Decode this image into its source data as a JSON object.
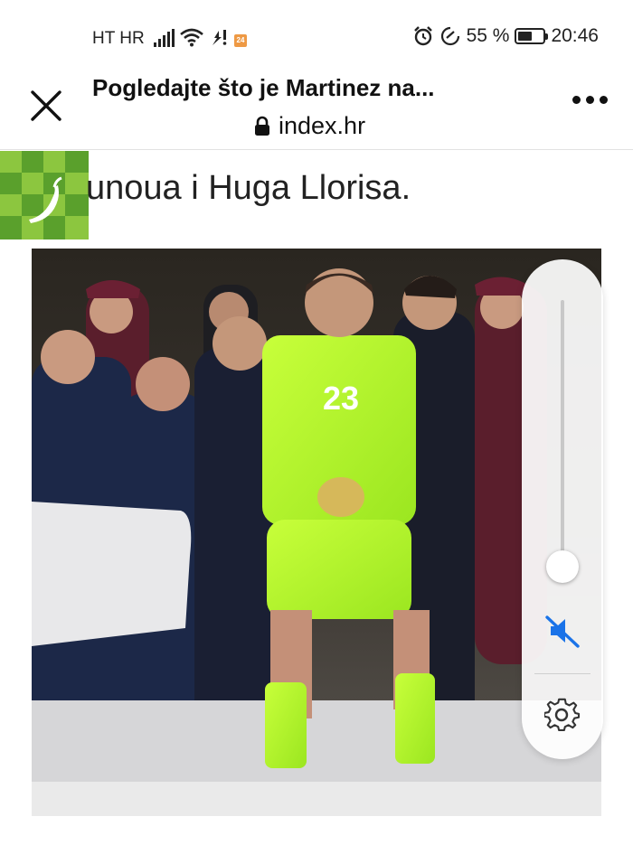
{
  "status_bar": {
    "carrier": "HT HR",
    "app_badge": "24",
    "battery_percent": 55,
    "battery_label": "55 %",
    "time": "20:46"
  },
  "browser": {
    "page_title": "Pogledajte što je Martinez na...",
    "url": "index.hr"
  },
  "article": {
    "visible_text": "unoua i Huga Llorisa."
  },
  "video_controls": {
    "volume_level": 0.05,
    "muted": true
  },
  "colors": {
    "accent_blue": "#1a73e8",
    "logo_green": "#5aa02c",
    "logo_green_light": "#8cc63f",
    "kit_green": "#b6ff2e"
  },
  "icons": [
    "close-icon",
    "lock-icon",
    "more-icon",
    "mute-icon",
    "settings-icon",
    "signal-icon",
    "wifi-icon",
    "alarm-icon",
    "battery-icon"
  ]
}
